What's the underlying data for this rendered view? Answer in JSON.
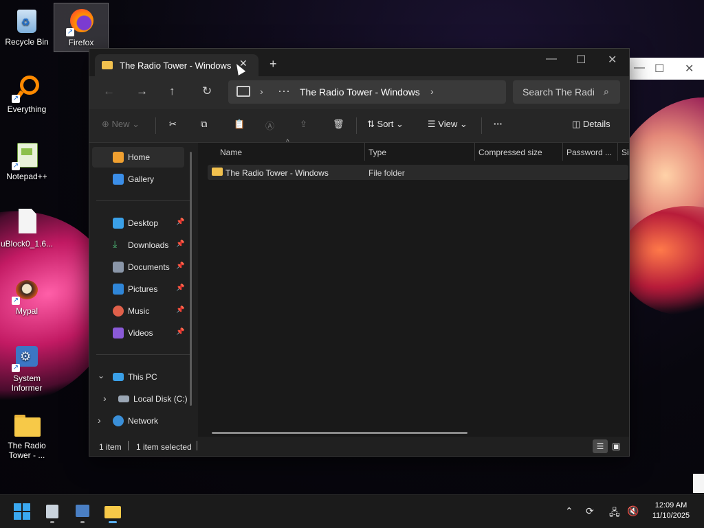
{
  "desktop": {
    "icons": [
      {
        "label": "Recycle Bin"
      },
      {
        "label": "Firefox"
      },
      {
        "label": "Everything"
      },
      {
        "label": "Notepad++"
      },
      {
        "label": "uBlock0_1.6..."
      },
      {
        "label": "Mypal"
      },
      {
        "label": "System Informer"
      },
      {
        "label": "The Radio Tower - ..."
      }
    ]
  },
  "explorer": {
    "tab_title": "The Radio Tower - Windows",
    "new_tab": "+",
    "address": {
      "overflow": "···",
      "crumb": "The Radio Tower - Windows"
    },
    "search_placeholder": "Search The Radi",
    "toolbar": {
      "new": "New",
      "sort": "Sort",
      "view": "View",
      "more": "···",
      "details": "Details"
    },
    "nav": {
      "home": "Home",
      "gallery": "Gallery",
      "desktop": "Desktop",
      "downloads": "Downloads",
      "documents": "Documents",
      "pictures": "Pictures",
      "music": "Music",
      "videos": "Videos",
      "this_pc": "This PC",
      "local_disk": "Local Disk (C:)",
      "network": "Network"
    },
    "columns": {
      "name": "Name",
      "type": "Type",
      "compressed": "Compressed size",
      "password": "Password ...",
      "size": "Si"
    },
    "rows": [
      {
        "name": "The Radio Tower - Windows",
        "type": "File folder"
      }
    ],
    "status": {
      "count": "1 item",
      "selected": "1 item selected"
    }
  },
  "taskbar": {
    "time": "12:09 AM",
    "date": "11/10/2025"
  }
}
